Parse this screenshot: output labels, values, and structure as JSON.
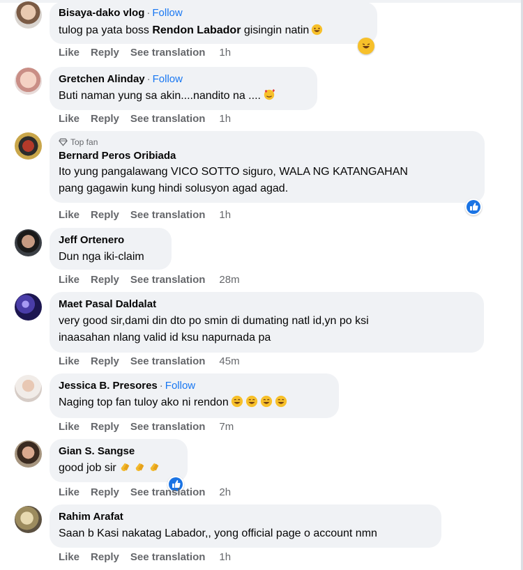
{
  "comments": [
    {
      "name": "Bisaya-dako vlog",
      "follow": "Follow",
      "text_pre": "tulog pa yata boss ",
      "mention": "Rendon Labador",
      "text_post": " gisingin natin",
      "actions": {
        "like": "Like",
        "reply": "Reply",
        "translate": "See translation",
        "time": "1h"
      }
    },
    {
      "name": "Gretchen Alinday",
      "follow": "Follow",
      "text": "Buti naman yung sa akin....nandito na ....",
      "actions": {
        "like": "Like",
        "reply": "Reply",
        "translate": "See translation",
        "time": "1h"
      }
    },
    {
      "badge": "Top fan",
      "name": "Bernard Peros Oribiada",
      "text_line1": "Ito yung pangalawang VICO SOTTO siguro, WALA NG KATANGAHAN",
      "text_line2": "pang gagawin kung hindi solusyon agad agad.",
      "actions": {
        "like": "Like",
        "reply": "Reply",
        "translate": "See translation",
        "time": "1h"
      }
    },
    {
      "name": "Jeff Ortenero",
      "text": "Dun nga iki-claim",
      "actions": {
        "like": "Like",
        "reply": "Reply",
        "translate": "See translation",
        "time": "28m"
      }
    },
    {
      "name": "Maet Pasal Daldalat",
      "text_line1": "very good sir,dami din dto po smin di dumating natl id,yn po ksi",
      "text_line2": "inaasahan nlang valid id ksu napurnada pa",
      "actions": {
        "like": "Like",
        "reply": "Reply",
        "translate": "See translation",
        "time": "45m"
      }
    },
    {
      "name": "Jessica B. Presores",
      "follow": "Follow",
      "text": "Naging top fan tuloy ako ni rendon",
      "actions": {
        "like": "Like",
        "reply": "Reply",
        "translate": "See translation",
        "time": "7m"
      }
    },
    {
      "name": "Gian S. Sangse",
      "text": "good job sir",
      "actions": {
        "like": "Like",
        "reply": "Reply",
        "translate": "See translation",
        "time": "2h"
      }
    },
    {
      "name": "Rahim Arafat",
      "text": "Saan b Kasi nakatag Labador,, yong official page o account nmn",
      "actions": {
        "like": "Like",
        "reply": "Reply",
        "translate": "See translation",
        "time": "1h"
      }
    }
  ],
  "colors": {
    "bubble": "#f0f2f5",
    "link": "#1877f2",
    "muted": "#65676b",
    "text": "#050505"
  }
}
